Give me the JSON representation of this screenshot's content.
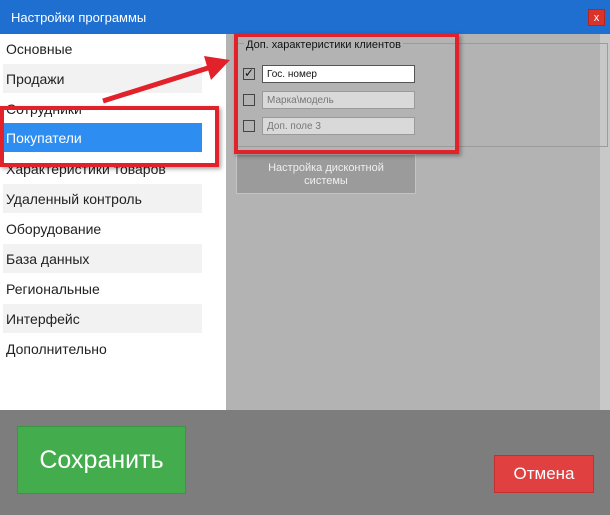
{
  "window": {
    "title": "Настройки программы",
    "close_glyph": "x"
  },
  "sidebar": {
    "items": [
      {
        "label": "Основные"
      },
      {
        "label": "Продажи"
      },
      {
        "label": "Сотрудники"
      },
      {
        "label": "Покупатели"
      },
      {
        "label": "Характеристики товаров"
      },
      {
        "label": "Удаленный контроль"
      },
      {
        "label": "Оборудование"
      },
      {
        "label": "База данных"
      },
      {
        "label": "Региональные"
      },
      {
        "label": "Интерфейс"
      },
      {
        "label": "Дополнительно"
      }
    ],
    "active_index": 3
  },
  "customer_fields": {
    "title": "Доп. характеристики клиентов",
    "rows": [
      {
        "checked": true,
        "value": "Гос. номер"
      },
      {
        "checked": false,
        "value": "Марка\\модель"
      },
      {
        "checked": false,
        "value": "Доп. поле 3"
      }
    ]
  },
  "discount_button": {
    "line1": "Настройка дисконтной",
    "line2": "системы"
  },
  "footer": {
    "save_label": "Сохранить",
    "cancel_label": "Отмена"
  },
  "colors": {
    "accent": "#1f6fd1",
    "selected": "#2d8df0",
    "highlight": "#e1222a",
    "save": "#43ac4c",
    "cancel": "#e04040"
  }
}
